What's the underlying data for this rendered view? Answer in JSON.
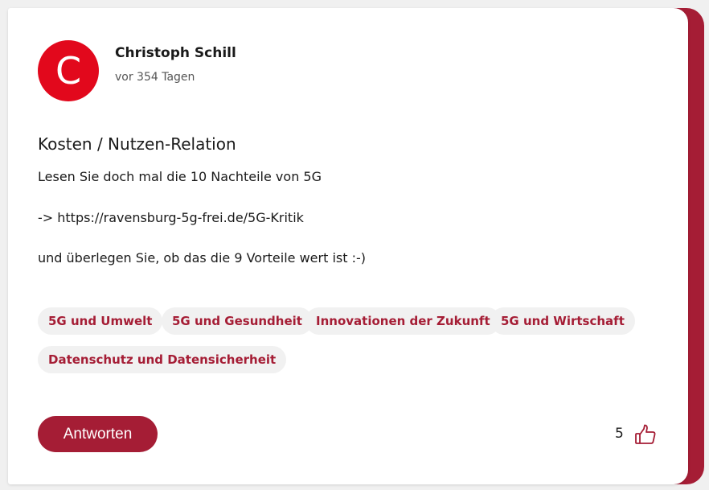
{
  "comment": {
    "avatar_initial": "C",
    "author": "Christoph Schill",
    "time_ago": "vor 354 Tagen",
    "title": "Kosten / Nutzen-Relation",
    "body": [
      "Lesen Sie doch mal die 10 Nachteile von 5G",
      "-> https://ravensburg-5g-frei.de/5G-Kritik",
      "und überlegen Sie, ob das die 9 Vorteile wert ist :-)"
    ],
    "tags": [
      "5G und Umwelt",
      "5G und Gesundheit",
      "Innovationen der Zukunft",
      "5G und Wirtschaft",
      "Datenschutz und Datensicherheit"
    ],
    "reply_label": "Antworten",
    "like_count": "5",
    "like_icon": "thumbs-up-icon"
  },
  "colors": {
    "accent": "#a51d35",
    "avatar": "#e2081c",
    "tag_background": "#f1f1f1"
  }
}
